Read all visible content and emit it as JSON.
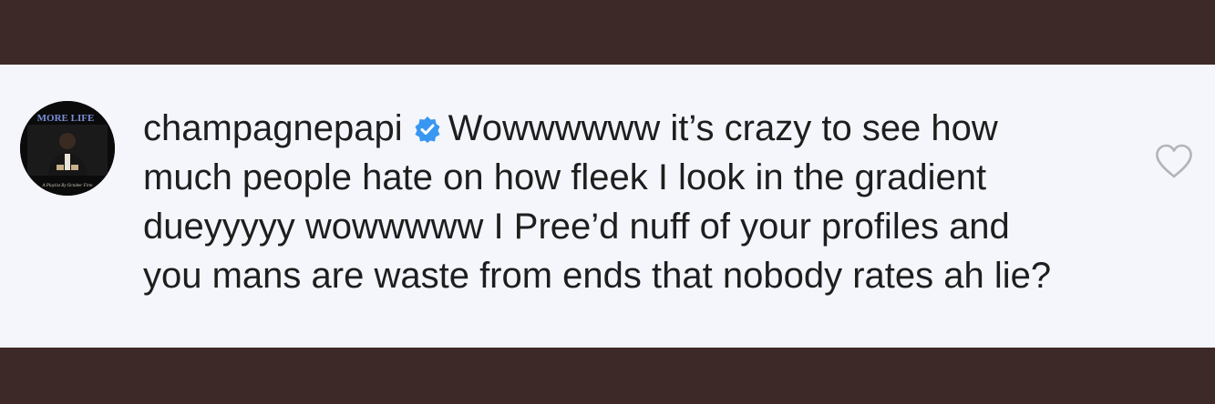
{
  "comment": {
    "username": "champagnepapi",
    "verified_icon": "verified-badge-icon",
    "text": "Wowwwwww it’s crazy to see how much people hate on how fleek I look in the gradient dueyyyyy wowwwww I Pree’d nuff of your profiles and you mans are waste from ends that nobody rates ah lie?",
    "like_icon": "heart-outline-icon"
  },
  "avatar": {
    "label": "MORE LIFE",
    "subtitle": "A Playlist By October Firm",
    "accent": "#7a8fd6"
  },
  "colors": {
    "background": "#3d2a28",
    "panel": "#f4f6fb",
    "text": "#1e1e1e",
    "verified": "#3897f0",
    "heart": "#b3b3b8"
  }
}
